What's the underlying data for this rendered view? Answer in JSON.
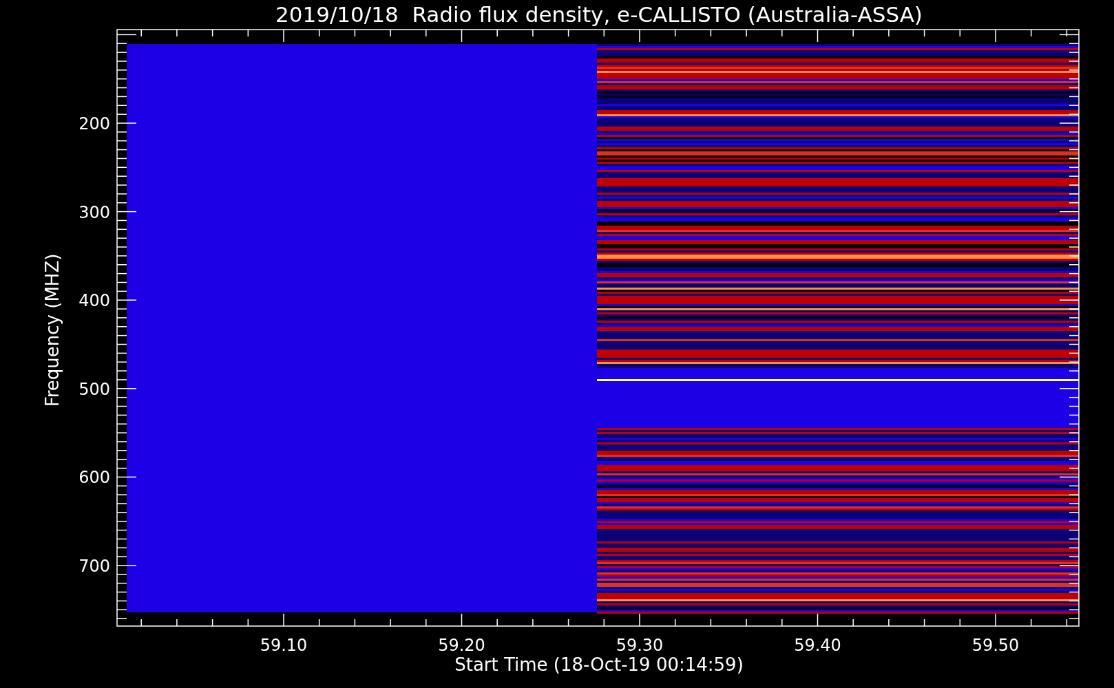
{
  "title": "2019/10/18  Radio flux density, e-CALLISTO (Australia-ASSA)",
  "xlabel": "Start Time (18-Oct-19 00:14:59)",
  "ylabel": "Frequency (MHZ)",
  "xticks": [
    "59.10",
    "59.20",
    "59.30",
    "59.40",
    "59.50"
  ],
  "yticks": [
    "200",
    "300",
    "400",
    "500",
    "600",
    "700"
  ]
}
